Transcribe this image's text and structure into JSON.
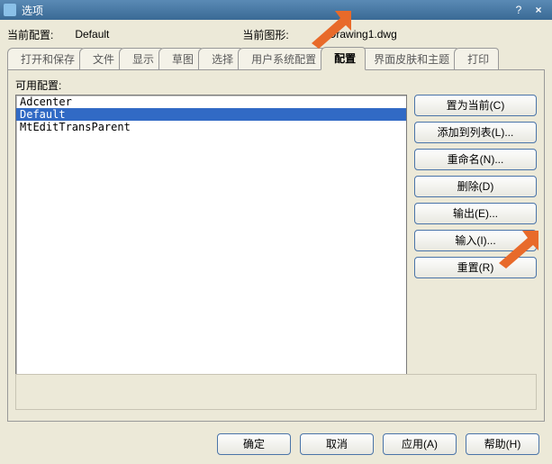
{
  "window": {
    "title": "选项",
    "btn_help": "?",
    "btn_close": "×"
  },
  "header": {
    "current_profile_label": "当前配置:",
    "current_profile_value": "Default",
    "current_drawing_label": "当前图形:",
    "current_drawing_value": "Drawing1.dwg"
  },
  "tabs": {
    "t0": "打开和保存",
    "t1": "文件",
    "t2": "显示",
    "t3": "草图",
    "t4": "选择",
    "t5": "用户系统配置",
    "t6": "配置",
    "t7": "界面皮肤和主题",
    "t8": "打印"
  },
  "profiles": {
    "available_label": "可用配置:",
    "items": {
      "i0": "Adcenter",
      "i1": "Default",
      "i2": "MtEditTransParent"
    }
  },
  "buttons": {
    "set_current": "置为当前(C)",
    "add_to_list": "添加到列表(L)...",
    "rename": "重命名(N)...",
    "delete": "删除(D)",
    "export": "输出(E)...",
    "import": "输入(I)...",
    "reset": "重置(R)"
  },
  "footer": {
    "ok": "确定",
    "cancel": "取消",
    "apply": "应用(A)",
    "help": "帮助(H)"
  }
}
